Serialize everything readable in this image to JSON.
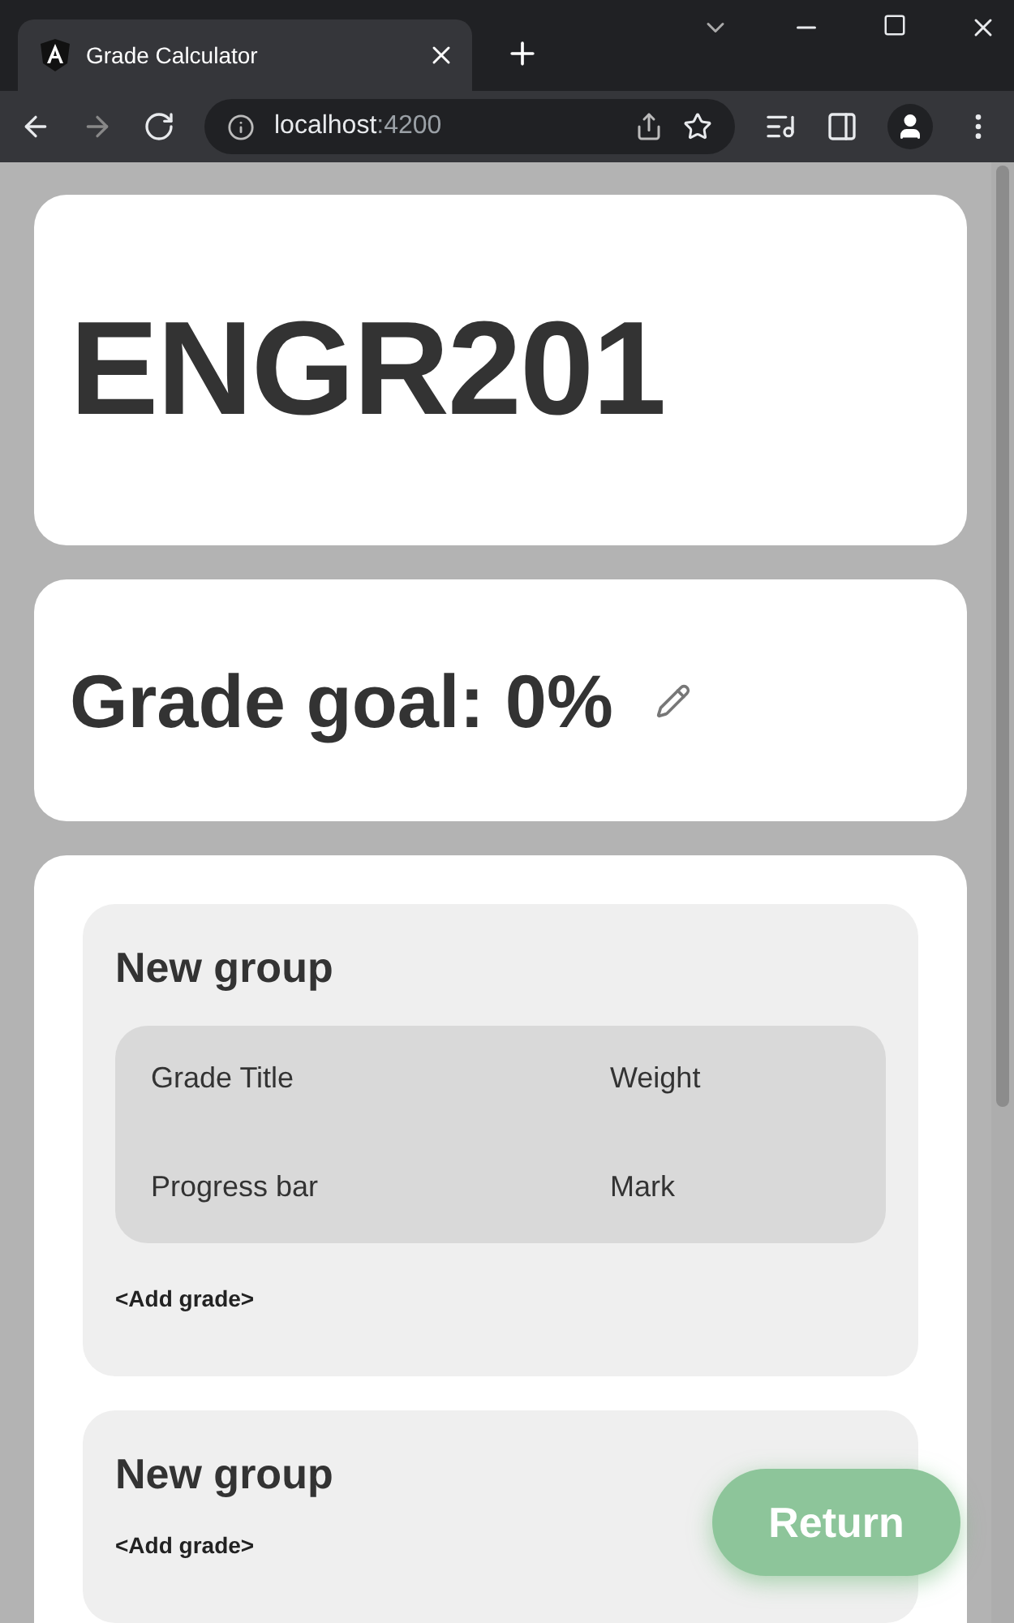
{
  "browser": {
    "tab_title": "Grade Calculator",
    "url_host": "localhost",
    "url_port": ":4200"
  },
  "course": {
    "title": "ENGR201"
  },
  "goal": {
    "text": "Grade goal: 0%"
  },
  "groups": [
    {
      "title": "New group",
      "header": [
        "Grade Title",
        "Weight",
        "Progress bar",
        "Mark"
      ],
      "add_label": "<Add grade>"
    },
    {
      "title": "New group",
      "add_label": "<Add grade>"
    }
  ],
  "return_button": "Return"
}
